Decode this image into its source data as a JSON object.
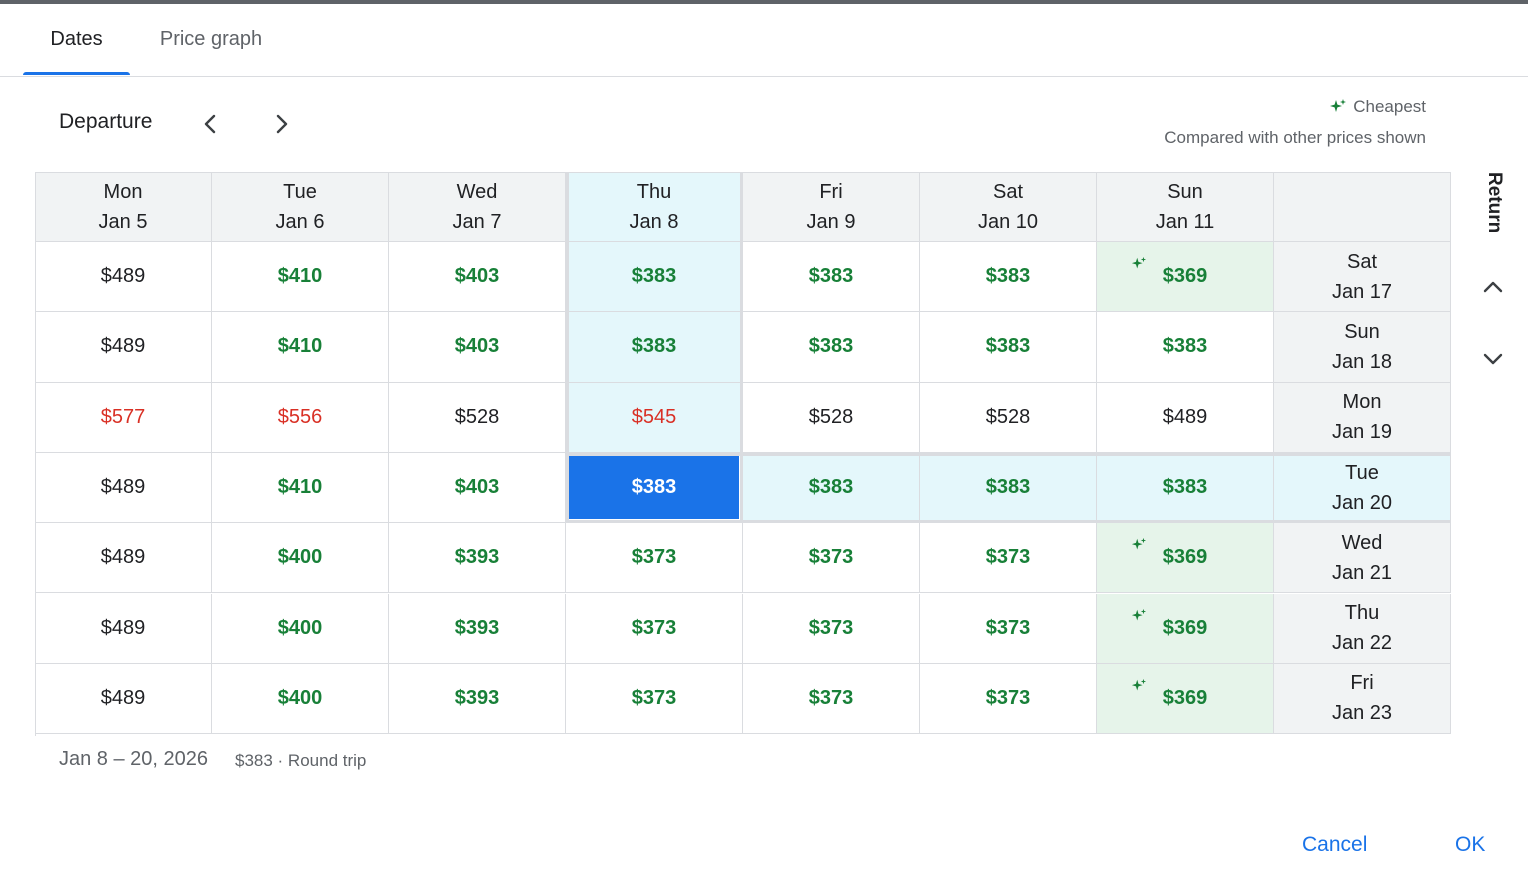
{
  "tabs": [
    {
      "label": "Dates",
      "active": true
    },
    {
      "label": "Price graph",
      "active": false
    }
  ],
  "toolbar": {
    "departure_label": "Departure",
    "prev_icon": "chevron-left-icon",
    "next_icon": "chevron-right-icon"
  },
  "legend": {
    "cheapest_label": "Cheapest",
    "compared_text": "Compared with other prices shown",
    "icon": "sparkle-icon"
  },
  "colors": {
    "green": "#188038",
    "red": "#d93025",
    "selected": "#1a73e8",
    "highlight": "#e4f7fb",
    "cheapest_bg": "#e6f4ea"
  },
  "columns": [
    {
      "day": "Mon",
      "date": "Jan 5"
    },
    {
      "day": "Tue",
      "date": "Jan 6"
    },
    {
      "day": "Wed",
      "date": "Jan 7"
    },
    {
      "day": "Thu",
      "date": "Jan 8"
    },
    {
      "day": "Fri",
      "date": "Jan 9"
    },
    {
      "day": "Sat",
      "date": "Jan 10"
    },
    {
      "day": "Sun",
      "date": "Jan 11"
    }
  ],
  "return_label": "Return",
  "rows": [
    {
      "day": "Sat",
      "date": "Jan 17",
      "prices": [
        {
          "v": "$489",
          "s": "normal"
        },
        {
          "v": "$410",
          "s": "green"
        },
        {
          "v": "$403",
          "s": "green"
        },
        {
          "v": "$383",
          "s": "green"
        },
        {
          "v": "$383",
          "s": "green"
        },
        {
          "v": "$383",
          "s": "green"
        },
        {
          "v": "$369",
          "s": "green",
          "cheapest": true
        }
      ]
    },
    {
      "day": "Sun",
      "date": "Jan 18",
      "prices": [
        {
          "v": "$489",
          "s": "normal"
        },
        {
          "v": "$410",
          "s": "green"
        },
        {
          "v": "$403",
          "s": "green"
        },
        {
          "v": "$383",
          "s": "green"
        },
        {
          "v": "$383",
          "s": "green"
        },
        {
          "v": "$383",
          "s": "green"
        },
        {
          "v": "$383",
          "s": "green"
        }
      ]
    },
    {
      "day": "Mon",
      "date": "Jan 19",
      "prices": [
        {
          "v": "$577",
          "s": "red"
        },
        {
          "v": "$556",
          "s": "red"
        },
        {
          "v": "$528",
          "s": "normal"
        },
        {
          "v": "$545",
          "s": "red"
        },
        {
          "v": "$528",
          "s": "normal"
        },
        {
          "v": "$528",
          "s": "normal"
        },
        {
          "v": "$489",
          "s": "normal"
        }
      ]
    },
    {
      "day": "Tue",
      "date": "Jan 20",
      "prices": [
        {
          "v": "$489",
          "s": "normal"
        },
        {
          "v": "$410",
          "s": "green"
        },
        {
          "v": "$403",
          "s": "green"
        },
        {
          "v": "$383",
          "s": "selected"
        },
        {
          "v": "$383",
          "s": "green"
        },
        {
          "v": "$383",
          "s": "green"
        },
        {
          "v": "$383",
          "s": "green"
        }
      ]
    },
    {
      "day": "Wed",
      "date": "Jan 21",
      "prices": [
        {
          "v": "$489",
          "s": "normal"
        },
        {
          "v": "$400",
          "s": "green"
        },
        {
          "v": "$393",
          "s": "green"
        },
        {
          "v": "$373",
          "s": "green"
        },
        {
          "v": "$373",
          "s": "green"
        },
        {
          "v": "$373",
          "s": "green"
        },
        {
          "v": "$369",
          "s": "green",
          "cheapest": true
        }
      ]
    },
    {
      "day": "Thu",
      "date": "Jan 22",
      "prices": [
        {
          "v": "$489",
          "s": "normal"
        },
        {
          "v": "$400",
          "s": "green"
        },
        {
          "v": "$393",
          "s": "green"
        },
        {
          "v": "$373",
          "s": "green"
        },
        {
          "v": "$373",
          "s": "green"
        },
        {
          "v": "$373",
          "s": "green"
        },
        {
          "v": "$369",
          "s": "green",
          "cheapest": true
        }
      ]
    },
    {
      "day": "Fri",
      "date": "Jan 23",
      "prices": [
        {
          "v": "$489",
          "s": "normal"
        },
        {
          "v": "$400",
          "s": "green"
        },
        {
          "v": "$393",
          "s": "green"
        },
        {
          "v": "$373",
          "s": "green"
        },
        {
          "v": "$373",
          "s": "green"
        },
        {
          "v": "$373",
          "s": "green"
        },
        {
          "v": "$369",
          "s": "green",
          "cheapest": true
        }
      ]
    }
  ],
  "selection": {
    "departure_col": 3,
    "return_row": 3
  },
  "footer": {
    "dates": "Jan 8 – 20, 2026",
    "price": "$383 · Round trip"
  },
  "actions": {
    "cancel": "Cancel",
    "ok": "OK"
  }
}
